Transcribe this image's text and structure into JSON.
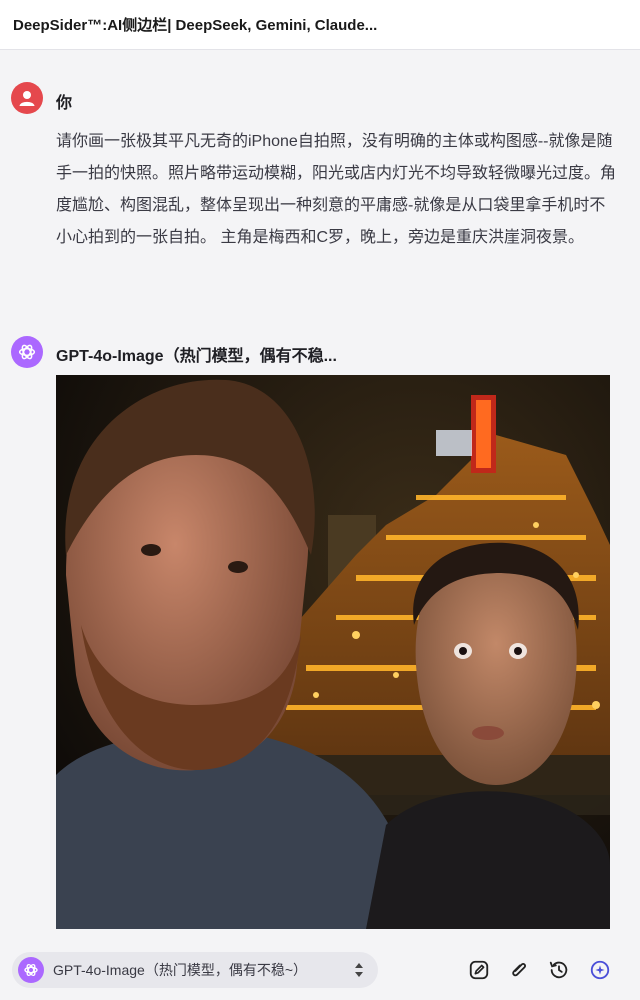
{
  "window": {
    "title": "DeepSider™:AI侧边栏| DeepSeek, Gemini, Claude..."
  },
  "user_message": {
    "author": "你",
    "text": "请你画一张极其平凡无奇的iPhone自拍照，没有明确的主体或构图感--就像是随手一拍的快照。照片略带运动模糊，阳光或店内灯光不均导致轻微曝光过度。角度尴尬、构图混乱，整体呈现出一种刻意的平庸感-就像是从口袋里拿手机时不小心拍到的一张自拍。 主角是梅西和C罗，晚上，旁边是重庆洪崖洞夜景。"
  },
  "bot_message": {
    "author": "GPT-4o-Image（热门模型，偶有不稳...",
    "image_description_icon": "generated-photo"
  },
  "composer": {
    "model_label": "GPT-4o-Image（热门模型，偶有不稳~）",
    "tools": [
      "edit-icon",
      "attach-icon",
      "history-icon",
      "new-chat-icon"
    ]
  },
  "colors": {
    "user_avatar": "#e5484d",
    "bot_avatar": "#ab68ff",
    "accent": "#4b4fd8"
  }
}
